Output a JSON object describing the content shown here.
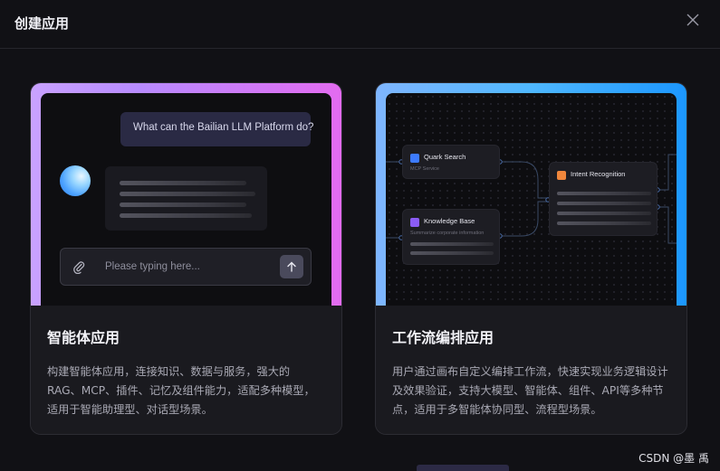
{
  "dialog": {
    "title": "创建应用",
    "close_icon": "close-icon"
  },
  "cards": [
    {
      "title": "智能体应用",
      "description": "构建智能体应用，连接知识、数据与服务，强大的RAG、MCP、插件、记忆及组件能力，适配多种模型，适用于智能助理型、对话型场景。",
      "preview": {
        "user_message": "What can the Bailian LLM Platform do?",
        "input_placeholder": "Please typing here...",
        "attach_icon": "paperclip-icon",
        "send_icon": "arrow-up-icon"
      },
      "accent_colors": [
        "#c9a2ff",
        "#e36bf0"
      ]
    },
    {
      "title": "工作流编排应用",
      "description": "用户通过画布自定义编排工作流，快速实现业务逻辑设计及效果验证，支持大模型、智能体、组件、API等多种节点，适用于多智能体协同型、流程型场景。",
      "preview": {
        "nodes": [
          {
            "title": "Quark Search",
            "subtitle": "MCP Service",
            "icon": "search-icon",
            "icon_color": "#3d7bff"
          },
          {
            "title": "Knowledge Base",
            "subtitle": "Summarize corporate information",
            "icon": "book-icon",
            "icon_color": "#8b5cf6"
          },
          {
            "title": "Intent Recognition",
            "subtitle": "",
            "icon": "intent-icon",
            "icon_color": "#f0873c"
          }
        ]
      },
      "accent_colors": [
        "#7fb6ff",
        "#1c97ff"
      ]
    }
  ],
  "watermark": "CSDN @墨  禹"
}
